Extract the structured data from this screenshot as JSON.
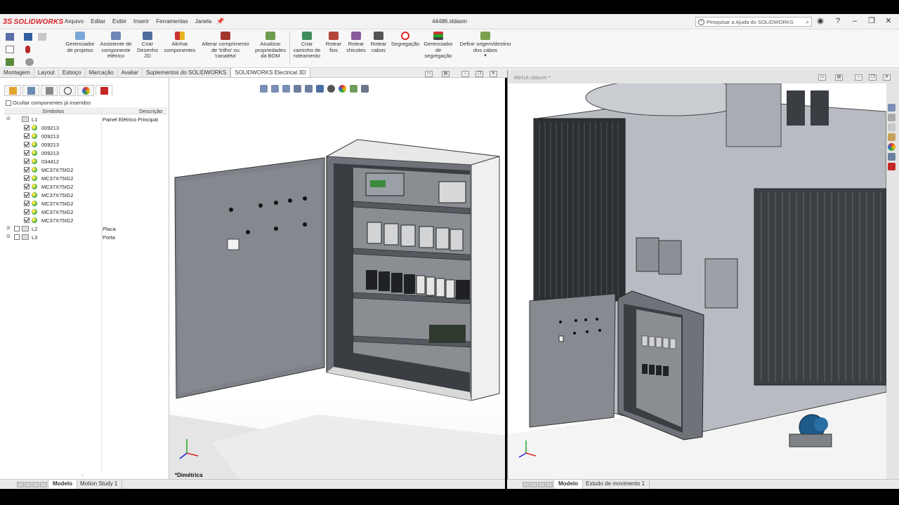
{
  "app": {
    "brand": "SOLIDWORKS",
    "document_title": "44486.sldasm",
    "menu": [
      "Arquivo",
      "Editar",
      "Exibir",
      "Inserir",
      "Ferramentas",
      "Janela"
    ],
    "help_search_placeholder": "Pesquisar a Ajuda do SOLIDWORKS"
  },
  "commands": [
    {
      "label": "Gerenciador\nde projetos",
      "icon": "project-manager-icon"
    },
    {
      "label": "Assistente de\ncomponente\nelétrico",
      "icon": "component-wizard-icon"
    },
    {
      "label": "Criar\nDesenho\n2D",
      "icon": "create-2d-drawing-icon"
    },
    {
      "label": "Alinhar\ncomponentes",
      "icon": "align-components-icon"
    },
    {
      "label": "Alterar comprimento\nde 'trilho' ou\n'canaleta'",
      "icon": "rail-length-icon"
    },
    {
      "label": "Atualizar\npropriedades\nda BOM",
      "icon": "bom-update-icon"
    },
    {
      "label": "Criar\ncaminho de\nroteamento",
      "icon": "routing-path-icon"
    },
    {
      "label": "Rotear\nfios",
      "icon": "route-wires-icon"
    },
    {
      "label": "Rotear\nchicotes",
      "icon": "route-harness-icon"
    },
    {
      "label": "Rotear\ncabos",
      "icon": "route-cables-icon"
    },
    {
      "label": "Segregação",
      "icon": "segregation-icon"
    },
    {
      "label": "Gerenciador\nde\nsegregação",
      "icon": "segregation-manager-icon"
    },
    {
      "label": "Definir origem/destino\ndos cabos",
      "icon": "cable-origin-icon"
    }
  ],
  "tabs": [
    "Montagem",
    "Layout",
    "Esboço",
    "Marcação",
    "Avaliar",
    "Suplementos do SOLIDWORKS",
    "SOLIDWORKS Electrical 3D"
  ],
  "active_tab": "SOLIDWORKS Electrical 3D",
  "left_pane": {
    "hide_inserted_label": "Ocultar componentes já inseridos",
    "col_symbols": "Símbolos",
    "col_description": "Descrição",
    "tree": [
      {
        "label": "L1",
        "description": "Painel Elétrico Principal",
        "level": 0,
        "checkbox": false,
        "icon": "box"
      },
      {
        "label": "009213",
        "description": "",
        "level": 1,
        "checkbox": true,
        "icon": "coil"
      },
      {
        "label": "009213",
        "description": "",
        "level": 1,
        "checkbox": true,
        "icon": "coil"
      },
      {
        "label": "009213",
        "description": "",
        "level": 1,
        "checkbox": true,
        "icon": "coil"
      },
      {
        "label": "009213",
        "description": "",
        "level": 1,
        "checkbox": true,
        "icon": "coil"
      },
      {
        "label": "034412",
        "description": "",
        "level": 1,
        "checkbox": true,
        "icon": "coil"
      },
      {
        "label": "MC37X75IG2",
        "description": "",
        "level": 1,
        "checkbox": true,
        "icon": "coil"
      },
      {
        "label": "MC37X75IG2",
        "description": "",
        "level": 1,
        "checkbox": true,
        "icon": "coil"
      },
      {
        "label": "MC37X75IG2",
        "description": "",
        "level": 1,
        "checkbox": true,
        "icon": "coil"
      },
      {
        "label": "MC37X75IG2",
        "description": "",
        "level": 1,
        "checkbox": true,
        "icon": "coil"
      },
      {
        "label": "MC37X75IG2",
        "description": "",
        "level": 1,
        "checkbox": true,
        "icon": "coil"
      },
      {
        "label": "MC37X75IG2",
        "description": "",
        "level": 1,
        "checkbox": true,
        "icon": "coil"
      },
      {
        "label": "MC37X75IG2",
        "description": "",
        "level": 1,
        "checkbox": true,
        "icon": "coil"
      },
      {
        "label": "L2",
        "description": "Placa",
        "level": 0,
        "checkbox": true,
        "icon": "box",
        "expandable": true
      },
      {
        "label": "L3",
        "description": "Porta",
        "level": 0,
        "checkbox": true,
        "icon": "box",
        "expandable": true
      }
    ]
  },
  "viewport1": {
    "view_label": "*Dimétrica"
  },
  "viewport2": {
    "document_title": "89418.sldasm *"
  },
  "bottom_tabs_left": [
    "Modelo",
    "Motion Study 1"
  ],
  "bottom_tabs_right": [
    "Modelo",
    "Estudo de movimento 1"
  ],
  "colors": {
    "accent": "#d8232a",
    "panel_grey": "#8a8d92",
    "door_grey": "#7d8187"
  }
}
